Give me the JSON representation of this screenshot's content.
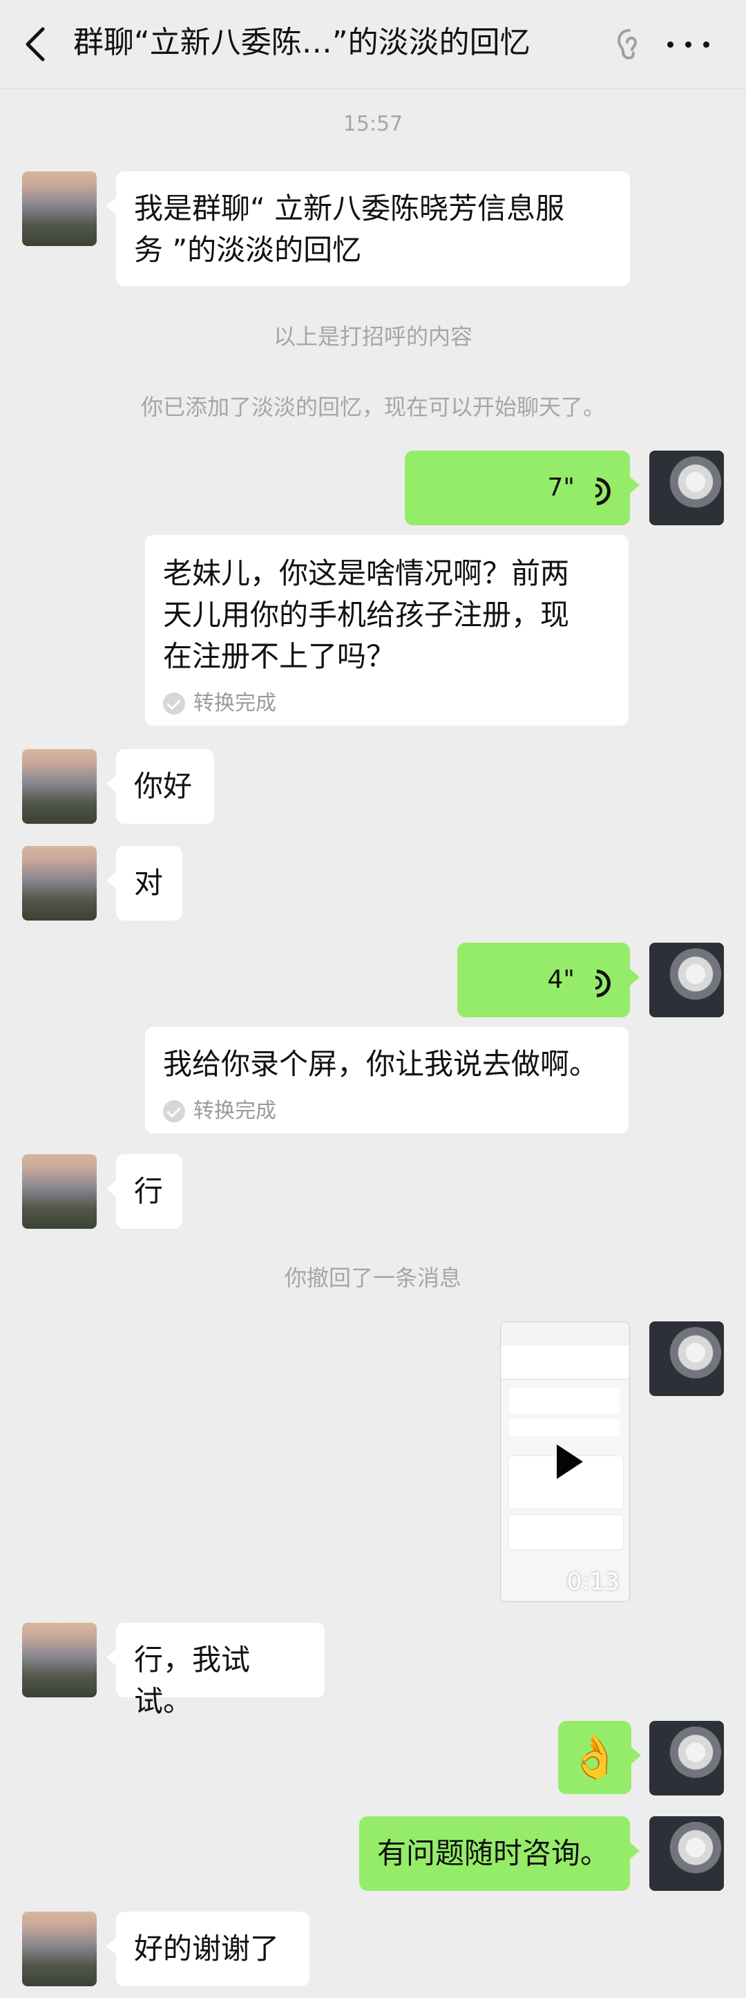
{
  "header": {
    "title": "群聊“立新八委陈…”的淡淡的回忆"
  },
  "timestamp": "15:57",
  "system_messages": [
    "以上是打招呼的内容",
    "你已添加了淡淡的回忆，现在可以开始聊天了。",
    "你撤回了一条消息"
  ],
  "messages": [
    {
      "sender": "her",
      "text": "我是群聊“ 立新八委陈晓芳信息服\n务 ”的淡淡的回忆"
    },
    {
      "sender": "me",
      "type": "voice",
      "duration": "7\""
    },
    {
      "sender": "me",
      "type": "transcript",
      "text": "老妹儿，你这是啥情况啊？前两\n天儿用你的手机给孩子注册，现\n在注册不上了吗？",
      "status": "转换完成"
    },
    {
      "sender": "her",
      "text": "你好"
    },
    {
      "sender": "her",
      "text": "对"
    },
    {
      "sender": "me",
      "type": "voice",
      "duration": "4\""
    },
    {
      "sender": "me",
      "type": "transcript",
      "text": "我给你录个屏，你让我说去做啊。",
      "status": "转换完成"
    },
    {
      "sender": "her",
      "text": "行"
    },
    {
      "sender": "me",
      "type": "video",
      "duration": "0:13"
    },
    {
      "sender": "her",
      "text": "行，我试试。"
    },
    {
      "sender": "me",
      "type": "emoji",
      "text": "👌"
    },
    {
      "sender": "me",
      "text": "有问题随时咨询。"
    },
    {
      "sender": "her",
      "text": "好的谢谢了"
    }
  ],
  "colors": {
    "background": "#ededed",
    "incoming_bubble": "#ffffff",
    "outgoing_bubble": "#95ec69",
    "system_text": "#a6a6a6"
  },
  "icons": [
    "back-icon",
    "ear-icon",
    "more-icon",
    "voice-wave-icon",
    "check-icon",
    "play-icon"
  ]
}
